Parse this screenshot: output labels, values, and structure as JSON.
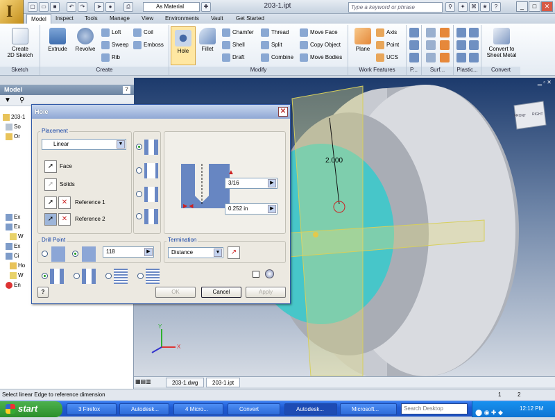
{
  "app": {
    "document_title": "203-1.ipt",
    "material": "As Material",
    "search_placeholder": "Type a keyword or phrase"
  },
  "tabs": [
    "Model",
    "Inspect",
    "Tools",
    "Manage",
    "View",
    "Environments",
    "Vault",
    "Get Started"
  ],
  "ribbon": {
    "sketch": {
      "create_2d_sketch": "Create\n2D Sketch",
      "label": "Sketch"
    },
    "create": {
      "extrude": "Extrude",
      "revolve": "Revolve",
      "loft": "Loft",
      "sweep": "Sweep",
      "rib": "Rib",
      "coil": "Coil",
      "emboss": "Emboss",
      "label": "Create"
    },
    "modify": {
      "hole": "Hole",
      "fillet": "Fillet",
      "chamfer": "Chamfer",
      "shell": "Shell",
      "draft": "Draft",
      "thread": "Thread",
      "split": "Split",
      "combine": "Combine",
      "move_face": "Move Face",
      "copy_object": "Copy Object",
      "move_bodies": "Move Bodies",
      "label": "Modify"
    },
    "work_features": {
      "plane": "Plane",
      "axis": "Axis",
      "point": "Point",
      "ucs": "UCS",
      "label": "Work Features"
    },
    "p_label": "P...",
    "surface_label": "Surf...",
    "plastic_label": "Plastic...",
    "convert": {
      "convert_sheet_metal": "Convert to\nSheet Metal",
      "label": "Convert"
    }
  },
  "browser": {
    "title": "Model",
    "items": [
      "203-1",
      "So",
      "Or",
      "",
      "",
      "",
      "",
      "",
      "",
      "Ex",
      "Ex",
      "W",
      "Ex",
      "Ci",
      "Ho",
      "W",
      "En"
    ]
  },
  "viewport": {
    "dimension": "2.000",
    "viewcube_front": "FRONT",
    "viewcube_right": "RIGHT",
    "axis_x": "X",
    "axis_y": "Y"
  },
  "doc_tabs": [
    "203-1.dwg",
    "203-1.ipt"
  ],
  "status": {
    "text": "Select linear Edge to reference dimension",
    "n1": "1",
    "n2": "2"
  },
  "dialog": {
    "title": "Hole",
    "placement_label": "Placement",
    "placement_type": "Linear",
    "face": "Face",
    "solids": "Solids",
    "reference1": "Reference 1",
    "reference2": "Reference 2",
    "depth": "3/16",
    "diameter": "0.252 in",
    "drill_point_label": "Drill Point",
    "drill_angle": "118",
    "termination_label": "Termination",
    "termination": "Distance",
    "ok": "OK",
    "cancel": "Cancel",
    "apply": "Apply",
    "help": "?"
  },
  "taskbar": {
    "start": "start",
    "tasks": [
      "3 Firefox",
      "Autodesk...",
      "4 Micro...",
      "Convert",
      "Autodesk...",
      "Microsoft..."
    ],
    "search": "Search Desktop",
    "clock": "12:12 PM"
  },
  "colors": {
    "cyan_face": "#47c6c9",
    "part_gray": "#b9bcc4",
    "accent_blue": "#315aa7"
  }
}
